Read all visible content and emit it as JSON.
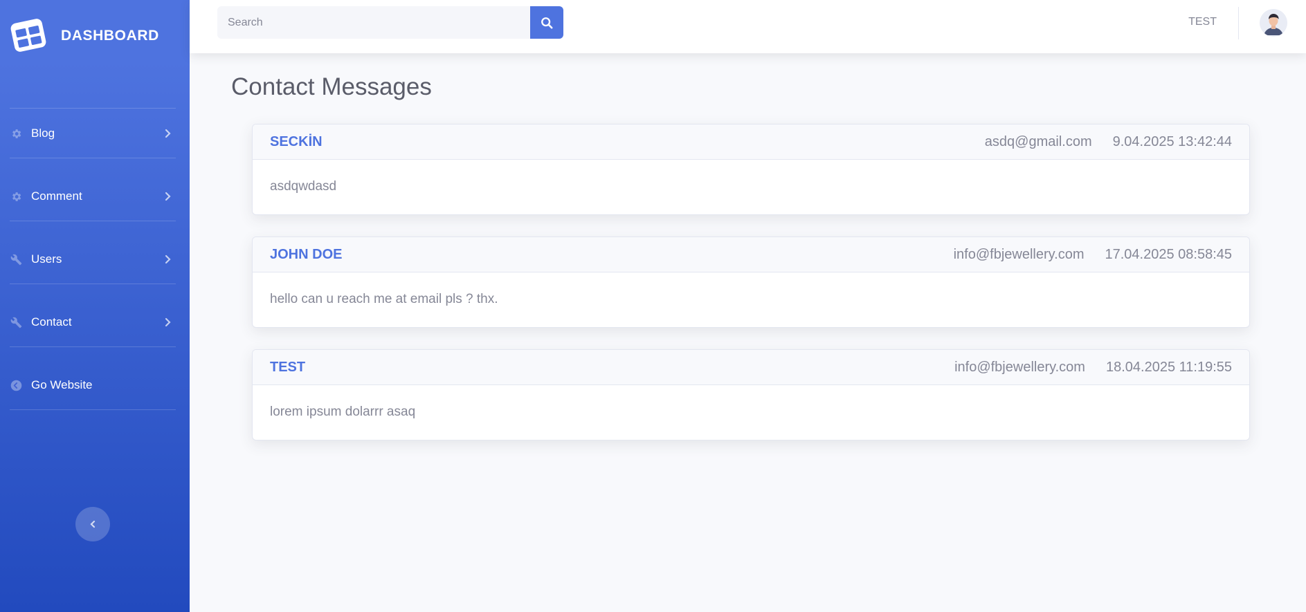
{
  "brand": {
    "title": "DASHBOARD"
  },
  "sidebar": {
    "items": [
      {
        "label": "Blog",
        "icon": "gear-icon"
      },
      {
        "label": "Comment",
        "icon": "gear-icon"
      },
      {
        "label": "Users",
        "icon": "wrench-icon"
      },
      {
        "label": "Contact",
        "icon": "wrench-icon"
      },
      {
        "label": "Go Website",
        "icon": "arrow-circle-left-icon"
      }
    ]
  },
  "topbar": {
    "search_placeholder": "Search",
    "user_name": "TEST"
  },
  "main": {
    "title": "Contact Messages",
    "messages": [
      {
        "name": "SECKİN",
        "email": "asdq@gmail.com",
        "date": "9.04.2025 13:42:44",
        "body": "asdqwdasd"
      },
      {
        "name": "JOHN DOE",
        "email": "info@fbjewellery.com",
        "date": "17.04.2025 08:58:45",
        "body": "hello can u reach me at email pls ? thx."
      },
      {
        "name": "TEST",
        "email": "info@fbjewellery.com",
        "date": "18.04.2025 11:19:55",
        "body": "lorem ipsum dolarrr asaq"
      }
    ]
  },
  "colors": {
    "primary": "#4e73df",
    "sidebar_gradient_end": "#224abe",
    "background": "#f8f9fc",
    "text_muted": "#858796"
  }
}
